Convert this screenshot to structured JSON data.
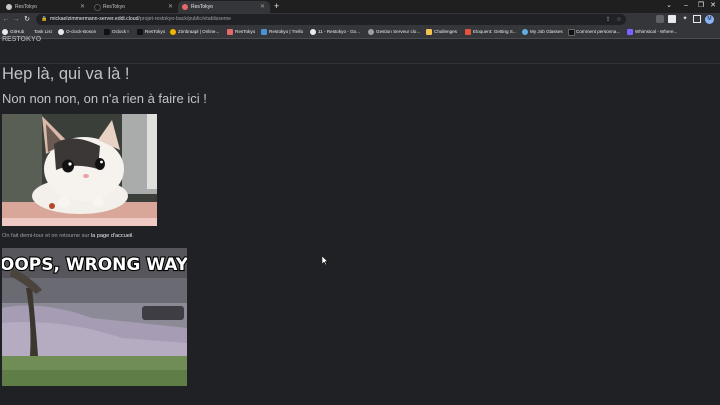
{
  "tabs": [
    {
      "title": "ResTokyo",
      "active": false,
      "favicon_color": "#c9c9c9"
    },
    {
      "title": "ResTokyo",
      "active": false,
      "favicon_color": "#1a1a1a"
    },
    {
      "title": "ResTokyo",
      "active": true,
      "favicon_color": "#e26a6a"
    }
  ],
  "new_tab_symbol": "+",
  "window_controls": {
    "minimize": "–",
    "restore": "❐",
    "close": "✕",
    "tab_search": "⌄"
  },
  "toolbar": {
    "back": "←",
    "forward": "→",
    "reload": "↻",
    "url_host": "mickaelzimmermann-server.eddi.cloud",
    "url_path": "/projet-restokyo-back/public/etablisseme"
  },
  "profile_initial": "M",
  "bookmarks": [
    {
      "label": "GitHub",
      "icon_color": "#e8eaed"
    },
    {
      "label": "Task List",
      "icon_color": "#35363a"
    },
    {
      "label": "O-clock-Boson",
      "icon_color": "#e8eaed"
    },
    {
      "label": "Oclock !",
      "icon_color": "#111111"
    },
    {
      "label": "ResTokyo",
      "icon_color": "#111111"
    },
    {
      "label": "Zimbraapl | Online...",
      "icon_color": "#f4b400"
    },
    {
      "label": "ResTokyo",
      "icon_color": "#e26a6a"
    },
    {
      "label": "Restokyo | Trello",
      "icon_color": "#4a90d9"
    },
    {
      "label": "11 - Restokyo - Go...",
      "icon_color": "#e8eaed"
    },
    {
      "label": "Gestion Serveur clo...",
      "icon_color": "#9aa0a6"
    },
    {
      "label": "Challenges",
      "icon_color": "#f2c14e"
    },
    {
      "label": "Eloquent: Getting S...",
      "icon_color": "#e5533d"
    },
    {
      "label": "My Job Glasses",
      "icon_color": "#5fb0e0"
    },
    {
      "label": "Comment personna...",
      "icon_color": "#111111"
    },
    {
      "label": "Whimsical - Where...",
      "icon_color": "#7b61ff"
    }
  ],
  "page": {
    "brand": "RESTOKYO",
    "heading": "Hep là, qui va là !",
    "subheading": "Non non non, on n'a rien à faire ici !",
    "caption_prefix": "On fait demi-tour et on retourne sur ",
    "caption_link": "la page d'accueil",
    "caption_suffix": ".",
    "meme_text": "OOPS, WRONG WAY"
  }
}
